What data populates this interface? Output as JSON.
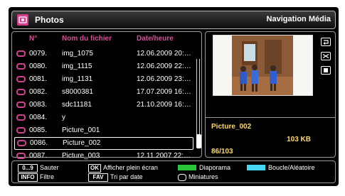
{
  "header": {
    "title": "Photos",
    "mode": "Navigation Média"
  },
  "list": {
    "columns": {
      "number": "N°",
      "filename": "Nom du fichier",
      "datetime": "Date/heure"
    },
    "rows": [
      {
        "number": "0079.",
        "name": "img_1075",
        "date": "12.06.2009 20:21..."
      },
      {
        "number": "0080.",
        "name": "img_1115",
        "date": "12.06.2009 22:28..."
      },
      {
        "number": "0081.",
        "name": "img_1131",
        "date": "12.06.2009 23:56..."
      },
      {
        "number": "0082.",
        "name": "s8000381",
        "date": "17.07.2009 16:58..."
      },
      {
        "number": "0083.",
        "name": "sdc11181",
        "date": "21.10.2009 16:55..."
      },
      {
        "number": "0084.",
        "name": "y",
        "date": ""
      },
      {
        "number": "0085.",
        "name": "Picture_001",
        "date": ""
      },
      {
        "number": "0086.",
        "name": "Picture_002",
        "date": ""
      },
      {
        "number": "0087.",
        "name": "Picture_003",
        "date": "12.11.2007 22:12..."
      }
    ],
    "selected_index": 7
  },
  "preview": {
    "filename": "Picture_002",
    "size": "103 KB",
    "position": "86/103"
  },
  "help": {
    "skip_key": "0...9",
    "skip_label": "Sauter",
    "fullscreen_key": "OK",
    "fullscreen_label": "Afficher plein écran",
    "slideshow_label": "Diaporama",
    "loop_label": "Boucle/Aléatoire",
    "filter_key": "INFO",
    "filter_label": "Filtre",
    "sort_key": "FAV",
    "sort_label": "Tri par date",
    "thumbnails_label": "Miniatures"
  },
  "colors": {
    "accent": "#d23f8e",
    "info_text": "#ffd86b",
    "slideshow_key": "#27c43a",
    "loop_key": "#47d6f0"
  },
  "icons": {
    "app": "photo-folder-icon",
    "row": "folder-icon",
    "side": [
      "repeat-icon",
      "shuffle-icon",
      "stop-icon"
    ],
    "thumbnails": "thumbnails-icon"
  }
}
